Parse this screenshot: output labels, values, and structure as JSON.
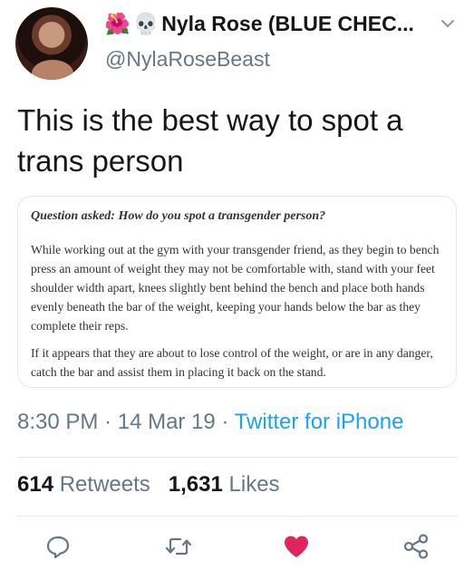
{
  "author": {
    "emoji_1": "🌺",
    "emoji_2": "💀",
    "name": "Nyla Rose (BLUE CHEC...",
    "handle": "@NylaRoseBeast"
  },
  "tweet": {
    "text": "This is the best way to spot a trans person"
  },
  "card": {
    "question": "Question asked: How do you spot a transgender person?",
    "paragraph_1": "While working out at the gym with your transgender friend, as they begin to bench press an amount of weight they may not be comfortable with, stand with your feet shoulder width apart, knees slightly bent behind the bench and place both hands evenly beneath the bar of the weight, keeping your hands below the bar as they complete their reps.",
    "paragraph_2": "If it appears that they are about to lose control of the weight, or are in any danger, catch the bar and assist them in placing it back on the stand."
  },
  "meta": {
    "time": "8:30 PM",
    "sep_1": " · ",
    "date": "14 Mar 19",
    "sep_2": " · ",
    "source": "Twitter for iPhone"
  },
  "stats": {
    "retweets_count": "614",
    "retweets_label": "Retweets",
    "likes_count": "1,631",
    "likes_label": "Likes"
  },
  "icons": {
    "reply": "reply-icon",
    "retweet": "retweet-icon",
    "like": "heart-icon",
    "share": "share-icon",
    "more": "chevron-down-icon"
  },
  "colors": {
    "like": "#e0245e",
    "link": "#1da1f2",
    "muted": "#657786"
  }
}
